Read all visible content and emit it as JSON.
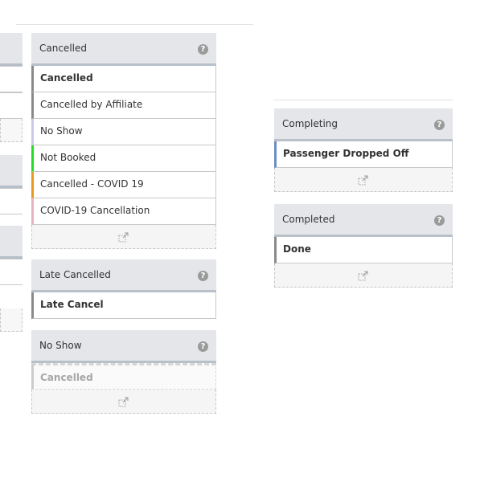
{
  "groups": [
    {
      "title": "Cancelled",
      "help": "?",
      "items": [
        {
          "label": "Cancelled",
          "color": "#8a8a8a",
          "bold": true
        },
        {
          "label": "Cancelled by Affiliate",
          "color": "#8a8a8a",
          "bold": false
        },
        {
          "label": "No Show",
          "color": "#c9c9ee",
          "bold": false
        },
        {
          "label": "Not Booked",
          "color": "#22dd22",
          "bold": false
        },
        {
          "label": "Cancelled - COVID 19",
          "color": "#e89a1c",
          "bold": false
        },
        {
          "label": "COVID-19 Cancellation",
          "color": "#e8b2be",
          "bold": false
        }
      ]
    },
    {
      "title": "Late Cancelled",
      "help": "?",
      "items": [
        {
          "label": "Late Cancel",
          "color": "#8a8a8a",
          "bold": true
        }
      ]
    },
    {
      "title": "No Show",
      "help": "?",
      "items": [
        {
          "label": "Cancelled",
          "color": "#cccccc",
          "bold": true,
          "disabled": true
        }
      ]
    },
    {
      "title": "Completing",
      "help": "?",
      "items": [
        {
          "label": "Passenger Dropped Off",
          "color": "#6a8ec0",
          "bold": true
        }
      ]
    },
    {
      "title": "Completed",
      "help": "?",
      "items": [
        {
          "label": "Done",
          "color": "#8a8a8a",
          "bold": true
        }
      ]
    }
  ]
}
